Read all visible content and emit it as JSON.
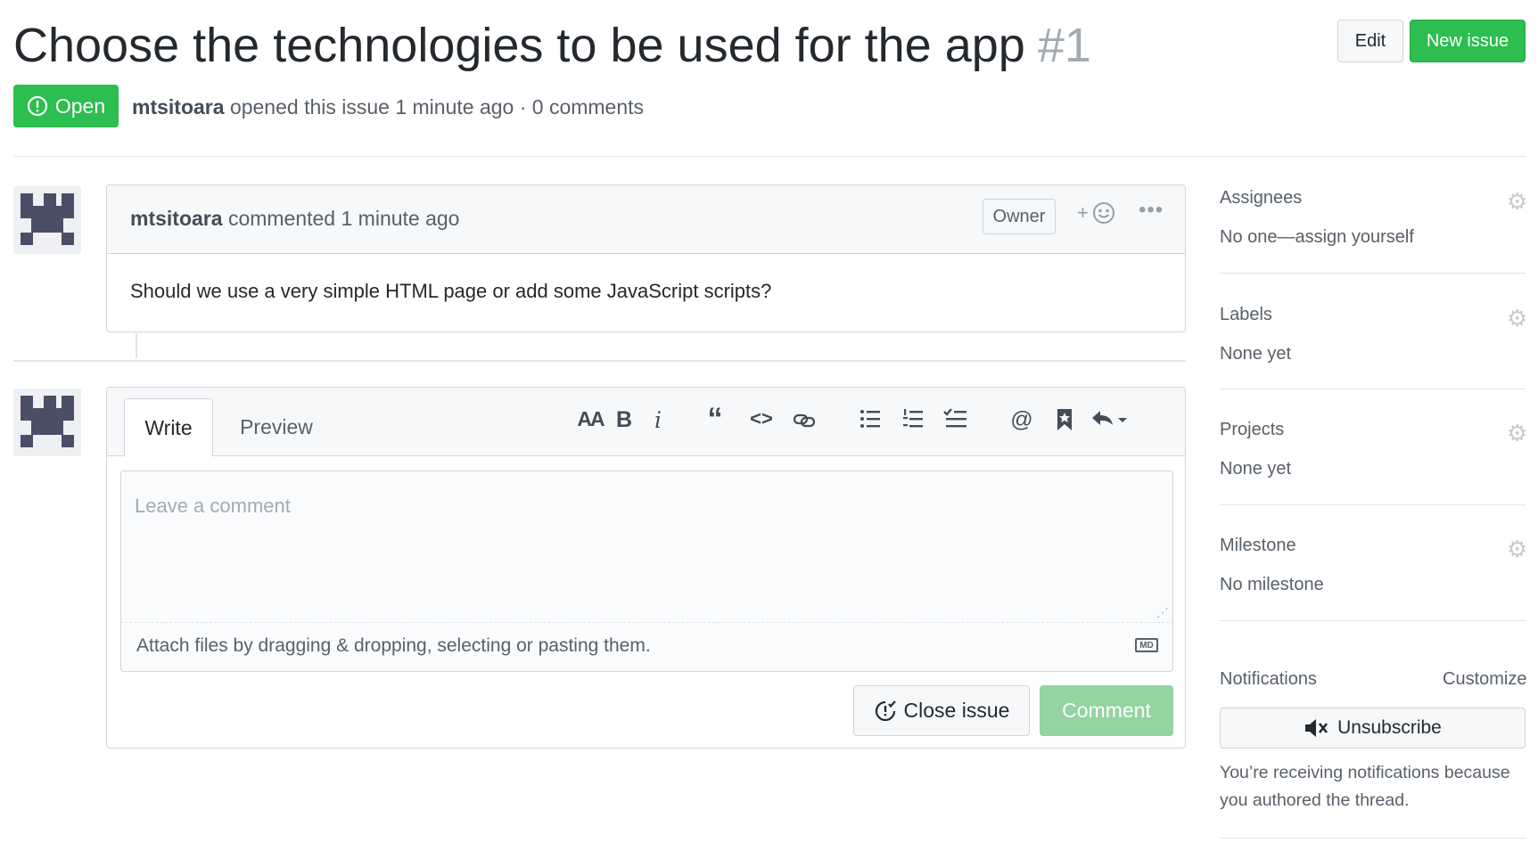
{
  "issue": {
    "title": "Choose the technologies to be used for the app",
    "number": "#1",
    "state": "Open",
    "author": "mtsitoara",
    "opened_text": "opened this issue 1 minute ago · 0 comments"
  },
  "header_buttons": {
    "edit": "Edit",
    "new_issue": "New issue"
  },
  "comment": {
    "author": "mtsitoara",
    "action": "commented 1 minute ago",
    "badge": "Owner",
    "body": "Should we use a very simple HTML page or add some JavaScript scripts?"
  },
  "form": {
    "tabs": [
      "Write",
      "Preview"
    ],
    "placeholder": "Leave a comment",
    "attach_text": "Attach files by dragging & dropping, selecting or pasting them.",
    "md_badge": "MD",
    "close_label": "Close issue",
    "comment_label": "Comment",
    "toolbar_icons": [
      "text-size-icon",
      "bold-icon",
      "italic-icon",
      "quote-icon",
      "code-icon",
      "link-icon",
      "bulleted-list-icon",
      "numbered-list-icon",
      "task-list-icon",
      "mention-icon",
      "reference-icon",
      "reply-icon"
    ]
  },
  "sidebar": {
    "sections": [
      {
        "heading": "Assignees",
        "value": "No one—assign yourself"
      },
      {
        "heading": "Labels",
        "value": "None yet"
      },
      {
        "heading": "Projects",
        "value": "None yet"
      },
      {
        "heading": "Milestone",
        "value": "No milestone"
      }
    ],
    "notifications": {
      "heading": "Notifications",
      "customize": "Customize",
      "unsubscribe": "Unsubscribe",
      "reason": "You’re receiving notifications because you authored the thread."
    }
  },
  "colors": {
    "primary_green": "#2cbe4e",
    "disabled_green": "#94d3a2",
    "muted_text": "#586069"
  }
}
